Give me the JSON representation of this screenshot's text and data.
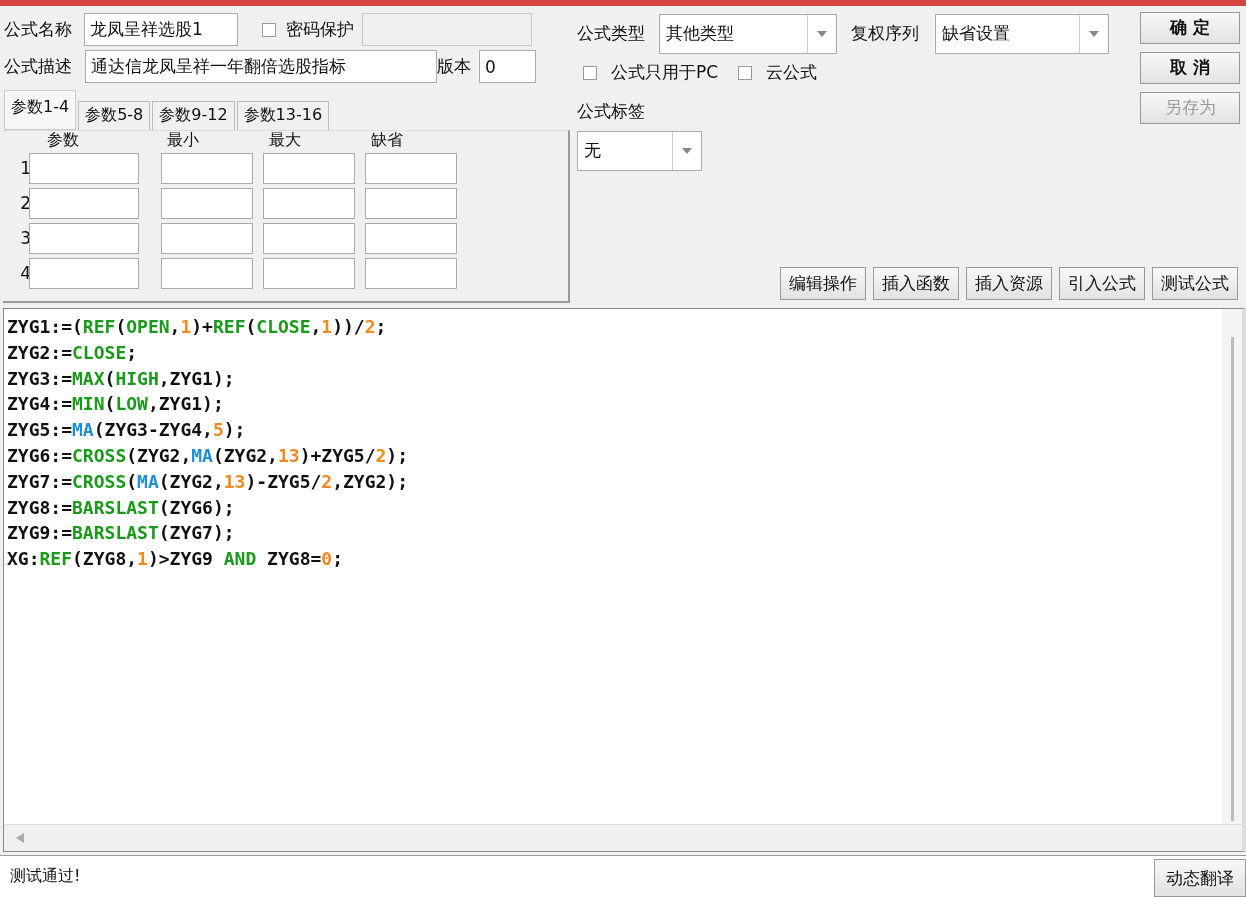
{
  "formula": {
    "name_label": "公式名称",
    "name_value": "龙凤呈祥选股1",
    "password": {
      "label": "密码保护",
      "checked": false
    },
    "desc_label": "公式描述",
    "desc_value": "通达信龙凤呈祥一年翻倍选股指标",
    "version_label": "版本",
    "version_value": "0"
  },
  "tabs": [
    {
      "label": "参数1-4",
      "selected": true
    },
    {
      "label": "参数5-8",
      "selected": false
    },
    {
      "label": "参数9-12",
      "selected": false
    },
    {
      "label": "参数13-16",
      "selected": false
    }
  ],
  "params": {
    "columns": [
      "参数",
      "最小",
      "最大",
      "缺省"
    ],
    "rows": [
      "1",
      "2",
      "3",
      "4"
    ]
  },
  "type": {
    "label": "公式类型",
    "value": "其他类型"
  },
  "adjust": {
    "label": "复权序列",
    "value": "缺省设置"
  },
  "options": [
    {
      "label": "公式只用于PC",
      "checked": false
    },
    {
      "label": "云公式",
      "checked": false
    }
  ],
  "tag": {
    "label": "公式标签",
    "value": "无"
  },
  "side_buttons": [
    {
      "label": "确  定",
      "disabled": false
    },
    {
      "label": "取  消",
      "disabled": false
    },
    {
      "label": "另存为",
      "disabled": true
    }
  ],
  "actions": [
    "编辑操作",
    "插入函数",
    "插入资源",
    "引入公式",
    "测试公式"
  ],
  "code": [
    [
      {
        "kind": "plain",
        "text": "ZYG1:=("
      },
      {
        "kind": "fn",
        "text": "REF"
      },
      {
        "kind": "plain",
        "text": "("
      },
      {
        "kind": "fn",
        "text": "OPEN"
      },
      {
        "kind": "plain",
        "text": ","
      },
      {
        "kind": "num",
        "text": "1"
      },
      {
        "kind": "plain",
        "text": ")+"
      },
      {
        "kind": "fn",
        "text": "REF"
      },
      {
        "kind": "plain",
        "text": "("
      },
      {
        "kind": "fn",
        "text": "CLOSE"
      },
      {
        "kind": "plain",
        "text": ","
      },
      {
        "kind": "num",
        "text": "1"
      },
      {
        "kind": "plain",
        "text": "))/"
      },
      {
        "kind": "num",
        "text": "2"
      },
      {
        "kind": "plain",
        "text": ";"
      }
    ],
    [
      {
        "kind": "plain",
        "text": "ZYG2:="
      },
      {
        "kind": "fn",
        "text": "CLOSE"
      },
      {
        "kind": "plain",
        "text": ";"
      }
    ],
    [
      {
        "kind": "plain",
        "text": "ZYG3:="
      },
      {
        "kind": "fn",
        "text": "MAX"
      },
      {
        "kind": "plain",
        "text": "("
      },
      {
        "kind": "fn",
        "text": "HIGH"
      },
      {
        "kind": "plain",
        "text": ",ZYG1);"
      }
    ],
    [
      {
        "kind": "plain",
        "text": "ZYG4:="
      },
      {
        "kind": "fn",
        "text": "MIN"
      },
      {
        "kind": "plain",
        "text": "("
      },
      {
        "kind": "fn",
        "text": "LOW"
      },
      {
        "kind": "plain",
        "text": ",ZYG1);"
      }
    ],
    [
      {
        "kind": "plain",
        "text": "ZYG5:="
      },
      {
        "kind": "ma",
        "text": "MA"
      },
      {
        "kind": "plain",
        "text": "(ZYG3-ZYG4,"
      },
      {
        "kind": "num",
        "text": "5"
      },
      {
        "kind": "plain",
        "text": ");"
      }
    ],
    [
      {
        "kind": "plain",
        "text": "ZYG6:="
      },
      {
        "kind": "fn",
        "text": "CROSS"
      },
      {
        "kind": "plain",
        "text": "(ZYG2,"
      },
      {
        "kind": "ma",
        "text": "MA"
      },
      {
        "kind": "plain",
        "text": "(ZYG2,"
      },
      {
        "kind": "num",
        "text": "13"
      },
      {
        "kind": "plain",
        "text": ")+ZYG5/"
      },
      {
        "kind": "num",
        "text": "2"
      },
      {
        "kind": "plain",
        "text": ");"
      }
    ],
    [
      {
        "kind": "plain",
        "text": "ZYG7:="
      },
      {
        "kind": "fn",
        "text": "CROSS"
      },
      {
        "kind": "plain",
        "text": "("
      },
      {
        "kind": "ma",
        "text": "MA"
      },
      {
        "kind": "plain",
        "text": "(ZYG2,"
      },
      {
        "kind": "num",
        "text": "13"
      },
      {
        "kind": "plain",
        "text": ")-ZYG5/"
      },
      {
        "kind": "num",
        "text": "2"
      },
      {
        "kind": "plain",
        "text": ",ZYG2);"
      }
    ],
    [
      {
        "kind": "plain",
        "text": "ZYG8:="
      },
      {
        "kind": "fn",
        "text": "BARSLAST"
      },
      {
        "kind": "plain",
        "text": "(ZYG6);"
      }
    ],
    [
      {
        "kind": "plain",
        "text": "ZYG9:="
      },
      {
        "kind": "fn",
        "text": "BARSLAST"
      },
      {
        "kind": "plain",
        "text": "(ZYG7);"
      }
    ],
    [
      {
        "kind": "plain",
        "text": "XG:"
      },
      {
        "kind": "fn",
        "text": "REF"
      },
      {
        "kind": "plain",
        "text": "(ZYG8,"
      },
      {
        "kind": "num",
        "text": "1"
      },
      {
        "kind": "plain",
        "text": ")>ZYG9 "
      },
      {
        "kind": "fn",
        "text": "AND"
      },
      {
        "kind": "plain",
        "text": " ZYG8="
      },
      {
        "kind": "num",
        "text": "0"
      },
      {
        "kind": "plain",
        "text": ";"
      }
    ]
  ],
  "status": {
    "message": "测试通过!",
    "button": "动态翻译"
  }
}
